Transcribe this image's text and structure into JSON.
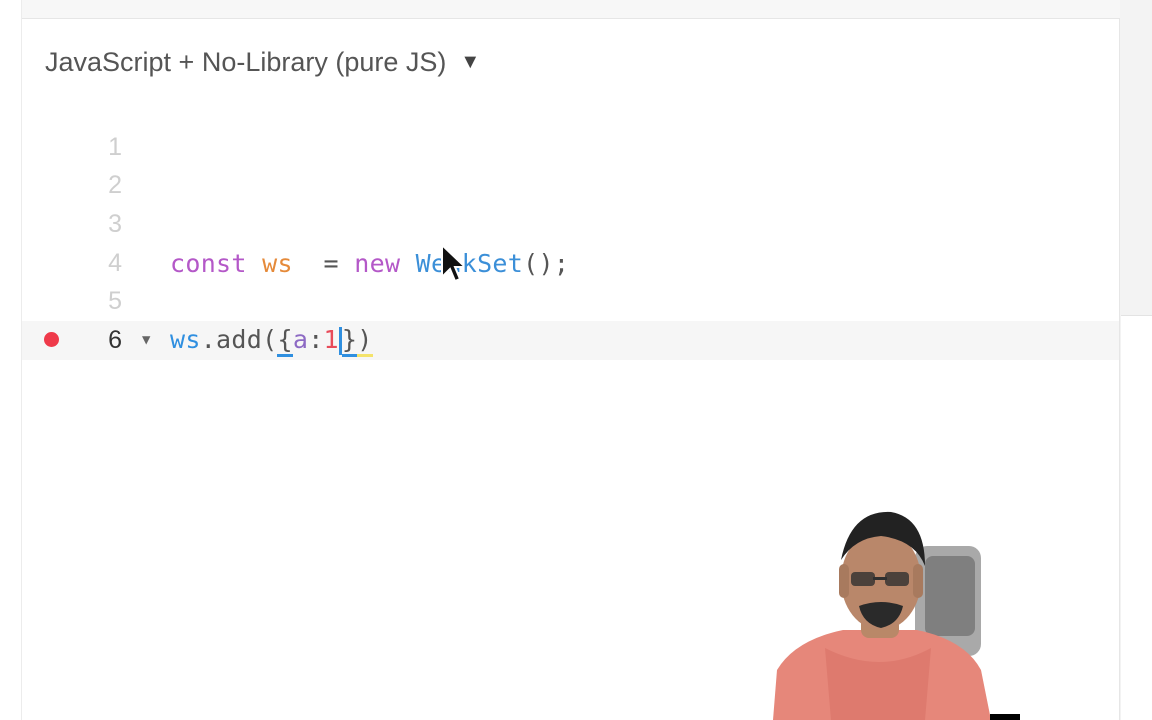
{
  "language_selector": {
    "label": "JavaScript + No-Library (pure JS)",
    "caret": "▼"
  },
  "editor": {
    "lines": [
      {
        "number": "1"
      },
      {
        "number": "2"
      },
      {
        "number": "3"
      },
      {
        "number": "4",
        "tokens": [
          "const",
          "ws",
          "=",
          "new",
          "WeakSet",
          "();"
        ]
      },
      {
        "number": "5"
      },
      {
        "number": "6",
        "tokens": [
          "ws",
          ".add(",
          "{",
          "a",
          ":",
          "1",
          "}",
          ")"
        ],
        "breakpoint": true,
        "fold": "▼",
        "active": true
      }
    ]
  },
  "colors": {
    "keyword": "#b458c8",
    "variable": "#e58a3a",
    "class": "#3b8fd8",
    "number": "#e84b5a",
    "breakpoint": "#ef3a4a"
  },
  "icons": {
    "caret": "triangle-down-icon",
    "fold": "fold-triangle-icon",
    "breakpoint": "breakpoint-dot-icon",
    "mouse": "mouse-pointer-icon"
  }
}
